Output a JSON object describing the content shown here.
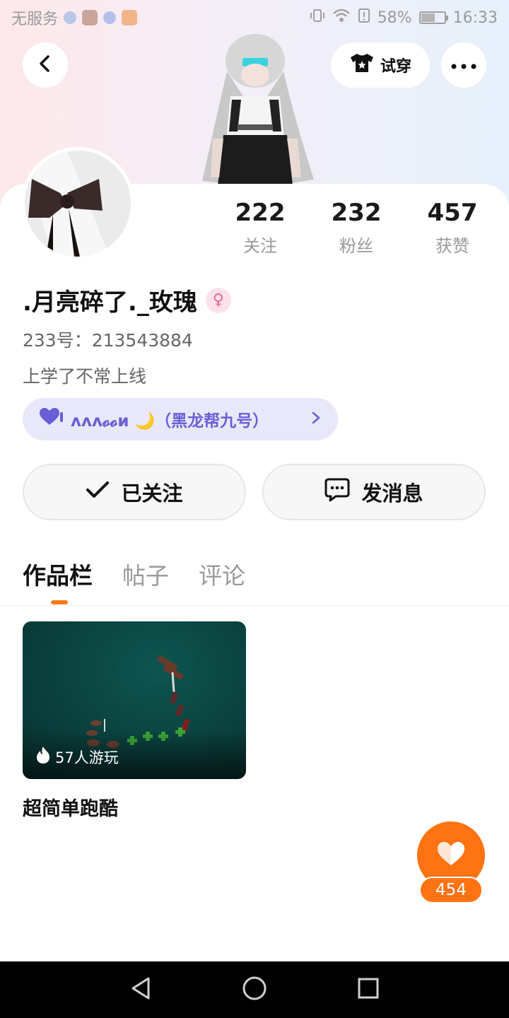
{
  "status_bar": {
    "carrier": "无服务",
    "battery": "58%",
    "battery_level": 0.58,
    "time": "16:33"
  },
  "header": {
    "tryon_label": "试穿"
  },
  "stats": [
    {
      "value": "222",
      "label": "关注"
    },
    {
      "value": "232",
      "label": "粉丝"
    },
    {
      "value": "457",
      "label": "获赞"
    }
  ],
  "profile": {
    "username": ".月亮碎了._玫瑰",
    "gender_symbol": "♀",
    "uid": "233号：213543884",
    "bio": "上学了不常上线",
    "badge_text": "ᴧᴧᴧ𝓸𝓸ᴎ 🌙（黑龙帮九号）"
  },
  "actions": {
    "follow_label": "已关注",
    "message_label": "发消息"
  },
  "tabs": [
    {
      "label": "作品栏",
      "active": true
    },
    {
      "label": "帖子",
      "active": false
    },
    {
      "label": "评论",
      "active": false
    }
  ],
  "works": [
    {
      "title": "超简单跑酷",
      "plays": "57人游玩"
    }
  ],
  "like": {
    "count": "454"
  },
  "colors": {
    "accent": "#ff7312",
    "badge_bg": "#e9e8fa",
    "badge_text": "#6a5fd6",
    "card_bg": "#0a3f3c"
  }
}
